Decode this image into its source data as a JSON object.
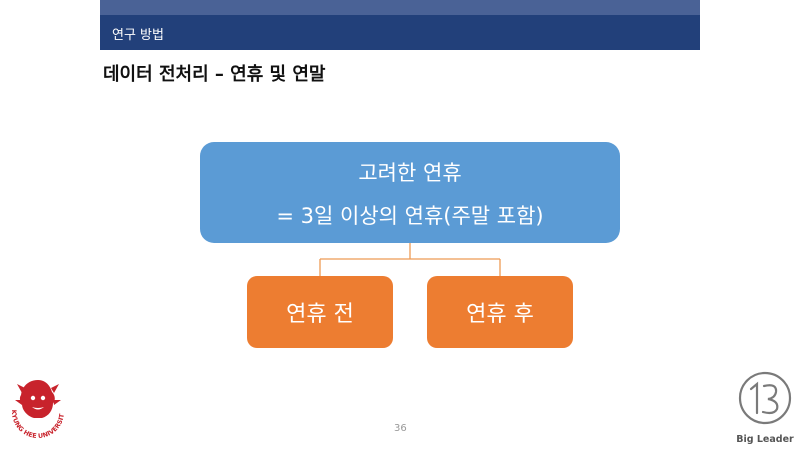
{
  "header": {
    "section": "연구 방법"
  },
  "slide": {
    "title": "데이터 전처리  – 연휴 및 연말"
  },
  "diagram": {
    "main_line1": "고려한 연휴",
    "main_line2": "= 3일 이상의 연휴(주말 포함)",
    "left_box": "연휴 전",
    "right_box": "연휴 후"
  },
  "footer": {
    "page_number": "36",
    "university": "KYUNG HEE UNIVERSITY",
    "brand": "Big Leader"
  },
  "colors": {
    "header_light": "#4a6296",
    "header_dark": "#22407a",
    "main_box": "#5b9bd5",
    "sub_box": "#ed7d31",
    "logo_red": "#c8232c"
  }
}
